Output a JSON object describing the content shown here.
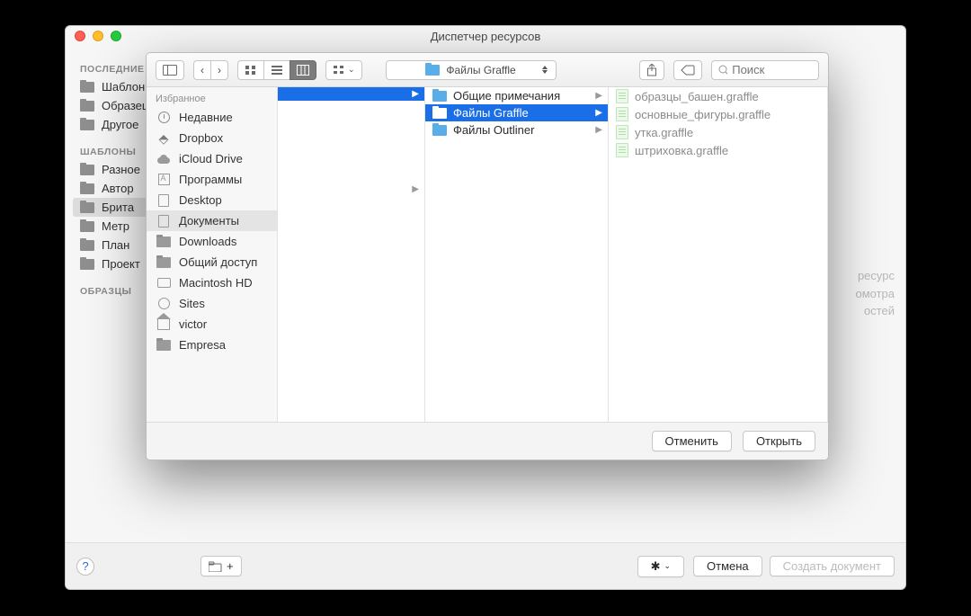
{
  "window": {
    "title": "Диспетчер ресурсов"
  },
  "sidebar": {
    "sections": [
      {
        "label": "ПОСЛЕДНИЕ РЕСУРСЫ",
        "items": [
          {
            "label": "Шаблон"
          },
          {
            "label": "Образец"
          },
          {
            "label": "Другое"
          }
        ]
      },
      {
        "label": "ШАБЛОНЫ",
        "items": [
          {
            "label": "Разное"
          },
          {
            "label": "Автор"
          },
          {
            "label": "Брита",
            "selected": true
          },
          {
            "label": "Метр"
          },
          {
            "label": "План"
          },
          {
            "label": "Проект"
          }
        ]
      },
      {
        "label": "ОБРАЗЦЫ",
        "items": []
      }
    ]
  },
  "preview_hint": {
    "l1": "ресурс",
    "l2": "омотра",
    "l3": "остей"
  },
  "bottom": {
    "cancel": "Отмена",
    "create": "Создать документ"
  },
  "open_panel": {
    "toolbar": {
      "path_label": "Файлы Graffle",
      "search_placeholder": "Поиск"
    },
    "favorites_header": "Избранное",
    "favorites": [
      {
        "label": "Недавние",
        "icon": "clock"
      },
      {
        "label": "Dropbox",
        "icon": "dropbox"
      },
      {
        "label": "iCloud Drive",
        "icon": "cloud"
      },
      {
        "label": "Программы",
        "icon": "app"
      },
      {
        "label": "Desktop",
        "icon": "doc"
      },
      {
        "label": "Документы",
        "icon": "doc",
        "selected": true
      },
      {
        "label": "Downloads",
        "icon": "folder"
      },
      {
        "label": "Общий доступ",
        "icon": "folder"
      },
      {
        "label": "Macintosh HD",
        "icon": "disk"
      },
      {
        "label": "Sites",
        "icon": "globe"
      },
      {
        "label": "victor",
        "icon": "house"
      },
      {
        "label": "Empresa",
        "icon": "folder"
      }
    ],
    "col1": [
      {
        "label": "",
        "has_children": true,
        "selected": true
      }
    ],
    "col2": [
      {
        "label": "Общие примечания",
        "has_children": true
      },
      {
        "label": "Файлы Graffle",
        "has_children": true,
        "selected": true
      },
      {
        "label": "Файлы Outliner",
        "has_children": true
      }
    ],
    "col3": [
      {
        "label": "образцы_башен.graffle"
      },
      {
        "label": "основные_фигуры.graffle"
      },
      {
        "label": "утка.graffle"
      },
      {
        "label": "штриховка.graffle"
      }
    ],
    "buttons": {
      "cancel": "Отменить",
      "open": "Открыть"
    }
  }
}
